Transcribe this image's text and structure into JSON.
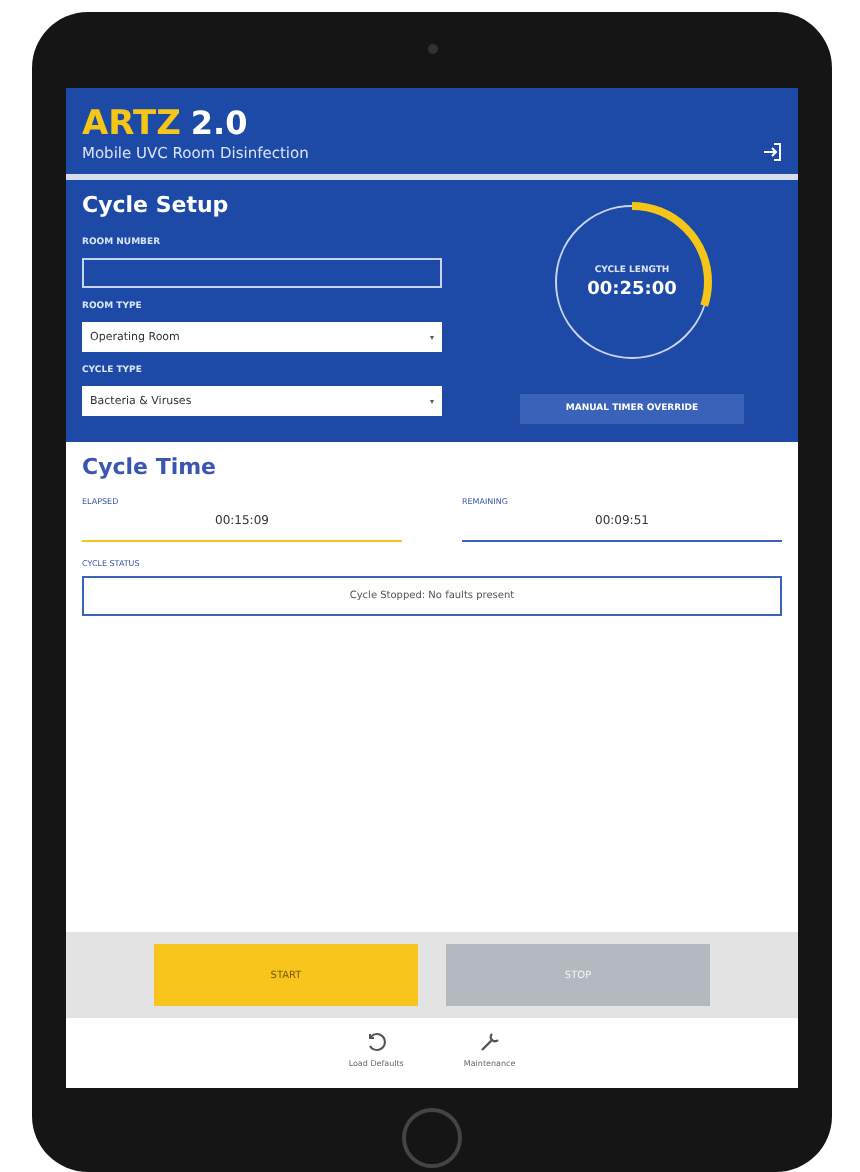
{
  "app": {
    "logo_name": "ARTZ",
    "logo_version": "2.0",
    "subtitle": "Mobile UVC Room Disinfection"
  },
  "cycle_setup": {
    "title": "Cycle Setup",
    "fields": [
      {
        "kind": "input",
        "label": "ROOM NUMBER"
      },
      {
        "kind": "select",
        "label": "ROOM TYPE",
        "value": "Operating Room"
      },
      {
        "kind": "select",
        "label": "CYCLE TYPE",
        "value": "Bacteria & Viruses"
      }
    ],
    "cycle_length": {
      "label": "CYCLE LENGTH",
      "value": "00:25:00",
      "level": 0.3
    },
    "override_button": "MANUAL TIMER OVERRIDE"
  },
  "cycle_time": {
    "title": "Cycle Time",
    "timers": [
      {
        "label": "ELAPSED",
        "value": "00:15:09",
        "color": "#f5c518"
      },
      {
        "label": "REMAINING",
        "value": "00:09:51",
        "color": "#3a62b8"
      }
    ],
    "status_label": "CYCLE STATUS",
    "status": "Cycle Stopped: No faults present"
  },
  "actions": [
    {
      "label": "START",
      "disabled": false
    },
    {
      "label": "STOP",
      "disabled": true
    }
  ],
  "bottom_nav": [
    {
      "kind": "reset",
      "label": "Load Defaults"
    },
    {
      "kind": "wrench",
      "label": "Maintenance"
    }
  ]
}
